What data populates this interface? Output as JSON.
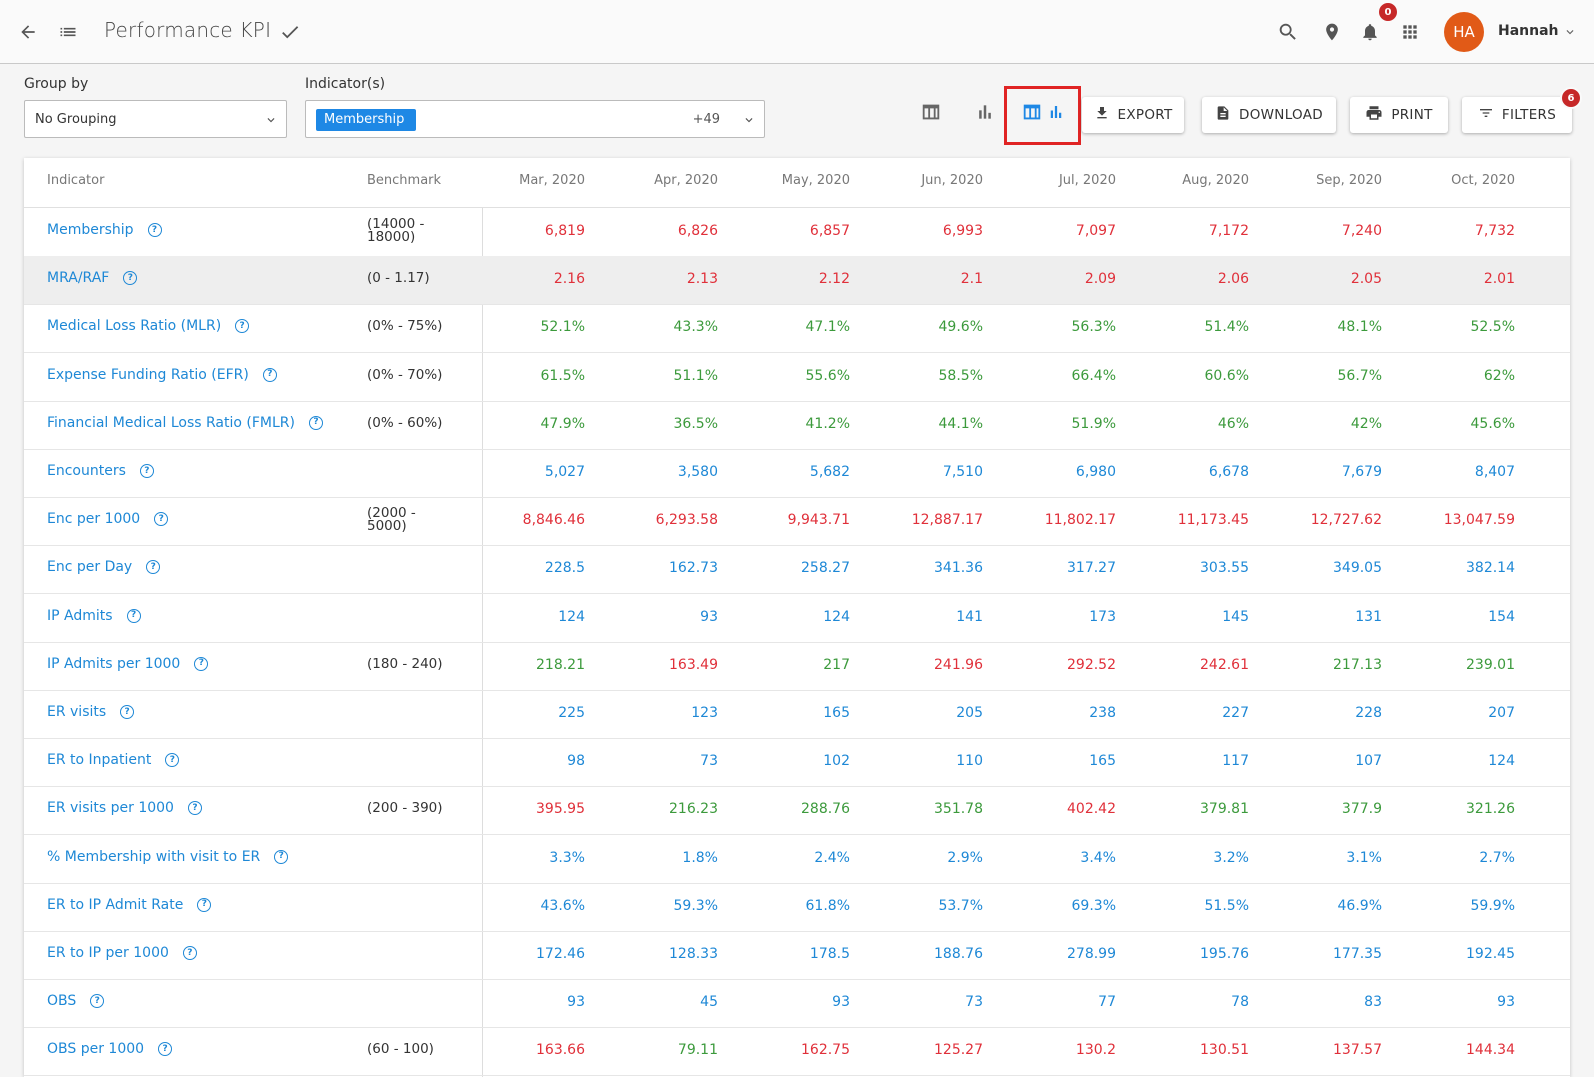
{
  "header": {
    "title": "Performance KPI",
    "notifications": "0",
    "avatar_initials": "HA",
    "user_name": "Hannah"
  },
  "controls": {
    "group_by_label": "Group by",
    "group_by_value": "No Grouping",
    "indicators_label": "Indicator(s)",
    "indicator_chip": "Membership",
    "indicator_more": "+49",
    "export_label": "EXPORT",
    "download_label": "DOWNLOAD",
    "print_label": "PRINT",
    "filters_label": "FILTERS",
    "filters_count": "6"
  },
  "table": {
    "col_indicator": "Indicator",
    "col_benchmark": "Benchmark",
    "months": [
      "Mar, 2020",
      "Apr, 2020",
      "May, 2020",
      "Jun, 2020",
      "Jul, 2020",
      "Aug, 2020",
      "Sep, 2020",
      "Oct, 2020"
    ],
    "rows": [
      {
        "name": "Membership",
        "bench": "(14000 -\n18000)",
        "values": [
          "6,819",
          "6,826",
          "6,857",
          "6,993",
          "7,097",
          "7,172",
          "7,240",
          "7,732"
        ],
        "colors": [
          "r",
          "r",
          "r",
          "r",
          "r",
          "r",
          "r",
          "r"
        ]
      },
      {
        "name": "MRA/RAF",
        "bench": "(0 - 1.17)",
        "values": [
          "2.16",
          "2.13",
          "2.12",
          "2.1",
          "2.09",
          "2.06",
          "2.05",
          "2.01"
        ],
        "colors": [
          "r",
          "r",
          "r",
          "r",
          "r",
          "r",
          "r",
          "r"
        ]
      },
      {
        "name": "Medical Loss Ratio (MLR)",
        "bench": "(0% - 75%)",
        "values": [
          "52.1%",
          "43.3%",
          "47.1%",
          "49.6%",
          "56.3%",
          "51.4%",
          "48.1%",
          "52.5%"
        ],
        "colors": [
          "g",
          "g",
          "g",
          "g",
          "g",
          "g",
          "g",
          "g"
        ]
      },
      {
        "name": "Expense Funding Ratio (EFR)",
        "bench": "(0% - 70%)",
        "values": [
          "61.5%",
          "51.1%",
          "55.6%",
          "58.5%",
          "66.4%",
          "60.6%",
          "56.7%",
          "62%"
        ],
        "colors": [
          "g",
          "g",
          "g",
          "g",
          "g",
          "g",
          "g",
          "g"
        ]
      },
      {
        "name": "Financial Medical Loss Ratio (FMLR)",
        "bench": "(0% - 60%)",
        "values": [
          "47.9%",
          "36.5%",
          "41.2%",
          "44.1%",
          "51.9%",
          "46%",
          "42%",
          "45.6%"
        ],
        "colors": [
          "g",
          "g",
          "g",
          "g",
          "g",
          "g",
          "g",
          "g"
        ]
      },
      {
        "name": "Encounters",
        "bench": "",
        "values": [
          "5,027",
          "3,580",
          "5,682",
          "7,510",
          "6,980",
          "6,678",
          "7,679",
          "8,407"
        ],
        "colors": [
          "b",
          "b",
          "b",
          "b",
          "b",
          "b",
          "b",
          "b"
        ]
      },
      {
        "name": "Enc per 1000",
        "bench": "(2000 -\n5000)",
        "values": [
          "8,846.46",
          "6,293.58",
          "9,943.71",
          "12,887.17",
          "11,802.17",
          "11,173.45",
          "12,727.62",
          "13,047.59"
        ],
        "colors": [
          "r",
          "r",
          "r",
          "r",
          "r",
          "r",
          "r",
          "r"
        ]
      },
      {
        "name": "Enc per Day",
        "bench": "",
        "values": [
          "228.5",
          "162.73",
          "258.27",
          "341.36",
          "317.27",
          "303.55",
          "349.05",
          "382.14"
        ],
        "colors": [
          "b",
          "b",
          "b",
          "b",
          "b",
          "b",
          "b",
          "b"
        ]
      },
      {
        "name": "IP Admits",
        "bench": "",
        "values": [
          "124",
          "93",
          "124",
          "141",
          "173",
          "145",
          "131",
          "154"
        ],
        "colors": [
          "b",
          "b",
          "b",
          "b",
          "b",
          "b",
          "b",
          "b"
        ]
      },
      {
        "name": "IP Admits per 1000",
        "bench": "(180 - 240)",
        "values": [
          "218.21",
          "163.49",
          "217",
          "241.96",
          "292.52",
          "242.61",
          "217.13",
          "239.01"
        ],
        "colors": [
          "g",
          "r",
          "g",
          "r",
          "r",
          "r",
          "g",
          "g"
        ]
      },
      {
        "name": "ER visits",
        "bench": "",
        "values": [
          "225",
          "123",
          "165",
          "205",
          "238",
          "227",
          "228",
          "207"
        ],
        "colors": [
          "b",
          "b",
          "b",
          "b",
          "b",
          "b",
          "b",
          "b"
        ]
      },
      {
        "name": "ER to Inpatient",
        "bench": "",
        "values": [
          "98",
          "73",
          "102",
          "110",
          "165",
          "117",
          "107",
          "124"
        ],
        "colors": [
          "b",
          "b",
          "b",
          "b",
          "b",
          "b",
          "b",
          "b"
        ]
      },
      {
        "name": "ER visits per 1000",
        "bench": "(200 - 390)",
        "values": [
          "395.95",
          "216.23",
          "288.76",
          "351.78",
          "402.42",
          "379.81",
          "377.9",
          "321.26"
        ],
        "colors": [
          "r",
          "g",
          "g",
          "g",
          "r",
          "g",
          "g",
          "g"
        ]
      },
      {
        "name": "% Membership with visit to ER",
        "bench": "",
        "values": [
          "3.3%",
          "1.8%",
          "2.4%",
          "2.9%",
          "3.4%",
          "3.2%",
          "3.1%",
          "2.7%"
        ],
        "colors": [
          "b",
          "b",
          "b",
          "b",
          "b",
          "b",
          "b",
          "b"
        ]
      },
      {
        "name": "ER to IP Admit Rate",
        "bench": "",
        "values": [
          "43.6%",
          "59.3%",
          "61.8%",
          "53.7%",
          "69.3%",
          "51.5%",
          "46.9%",
          "59.9%"
        ],
        "colors": [
          "b",
          "b",
          "b",
          "b",
          "b",
          "b",
          "b",
          "b"
        ]
      },
      {
        "name": "ER to IP per 1000",
        "bench": "",
        "values": [
          "172.46",
          "128.33",
          "178.5",
          "188.76",
          "278.99",
          "195.76",
          "177.35",
          "192.45"
        ],
        "colors": [
          "b",
          "b",
          "b",
          "b",
          "b",
          "b",
          "b",
          "b"
        ]
      },
      {
        "name": "OBS",
        "bench": "",
        "values": [
          "93",
          "45",
          "93",
          "73",
          "77",
          "78",
          "83",
          "93"
        ],
        "colors": [
          "b",
          "b",
          "b",
          "b",
          "b",
          "b",
          "b",
          "b"
        ]
      },
      {
        "name": "OBS per 1000",
        "bench": "(60 - 100)",
        "values": [
          "163.66",
          "79.11",
          "162.75",
          "125.27",
          "130.2",
          "130.51",
          "137.57",
          "144.34"
        ],
        "colors": [
          "r",
          "g",
          "r",
          "r",
          "r",
          "r",
          "r",
          "r"
        ]
      }
    ]
  },
  "colors": {
    "red": "#e0303a",
    "green": "#3c9a3c",
    "blue": "#1e88d6",
    "accent": "#1e88e5"
  },
  "icons": [
    "back-arrow-icon",
    "list-icon",
    "check-icon",
    "search-icon",
    "location-pin-icon",
    "bell-icon",
    "apps-grid-icon",
    "chevron-down-icon",
    "table-view-icon",
    "chart-view-icon",
    "table-chart-view-icon",
    "download-icon",
    "file-icon",
    "print-icon",
    "filter-icon",
    "help-icon"
  ]
}
